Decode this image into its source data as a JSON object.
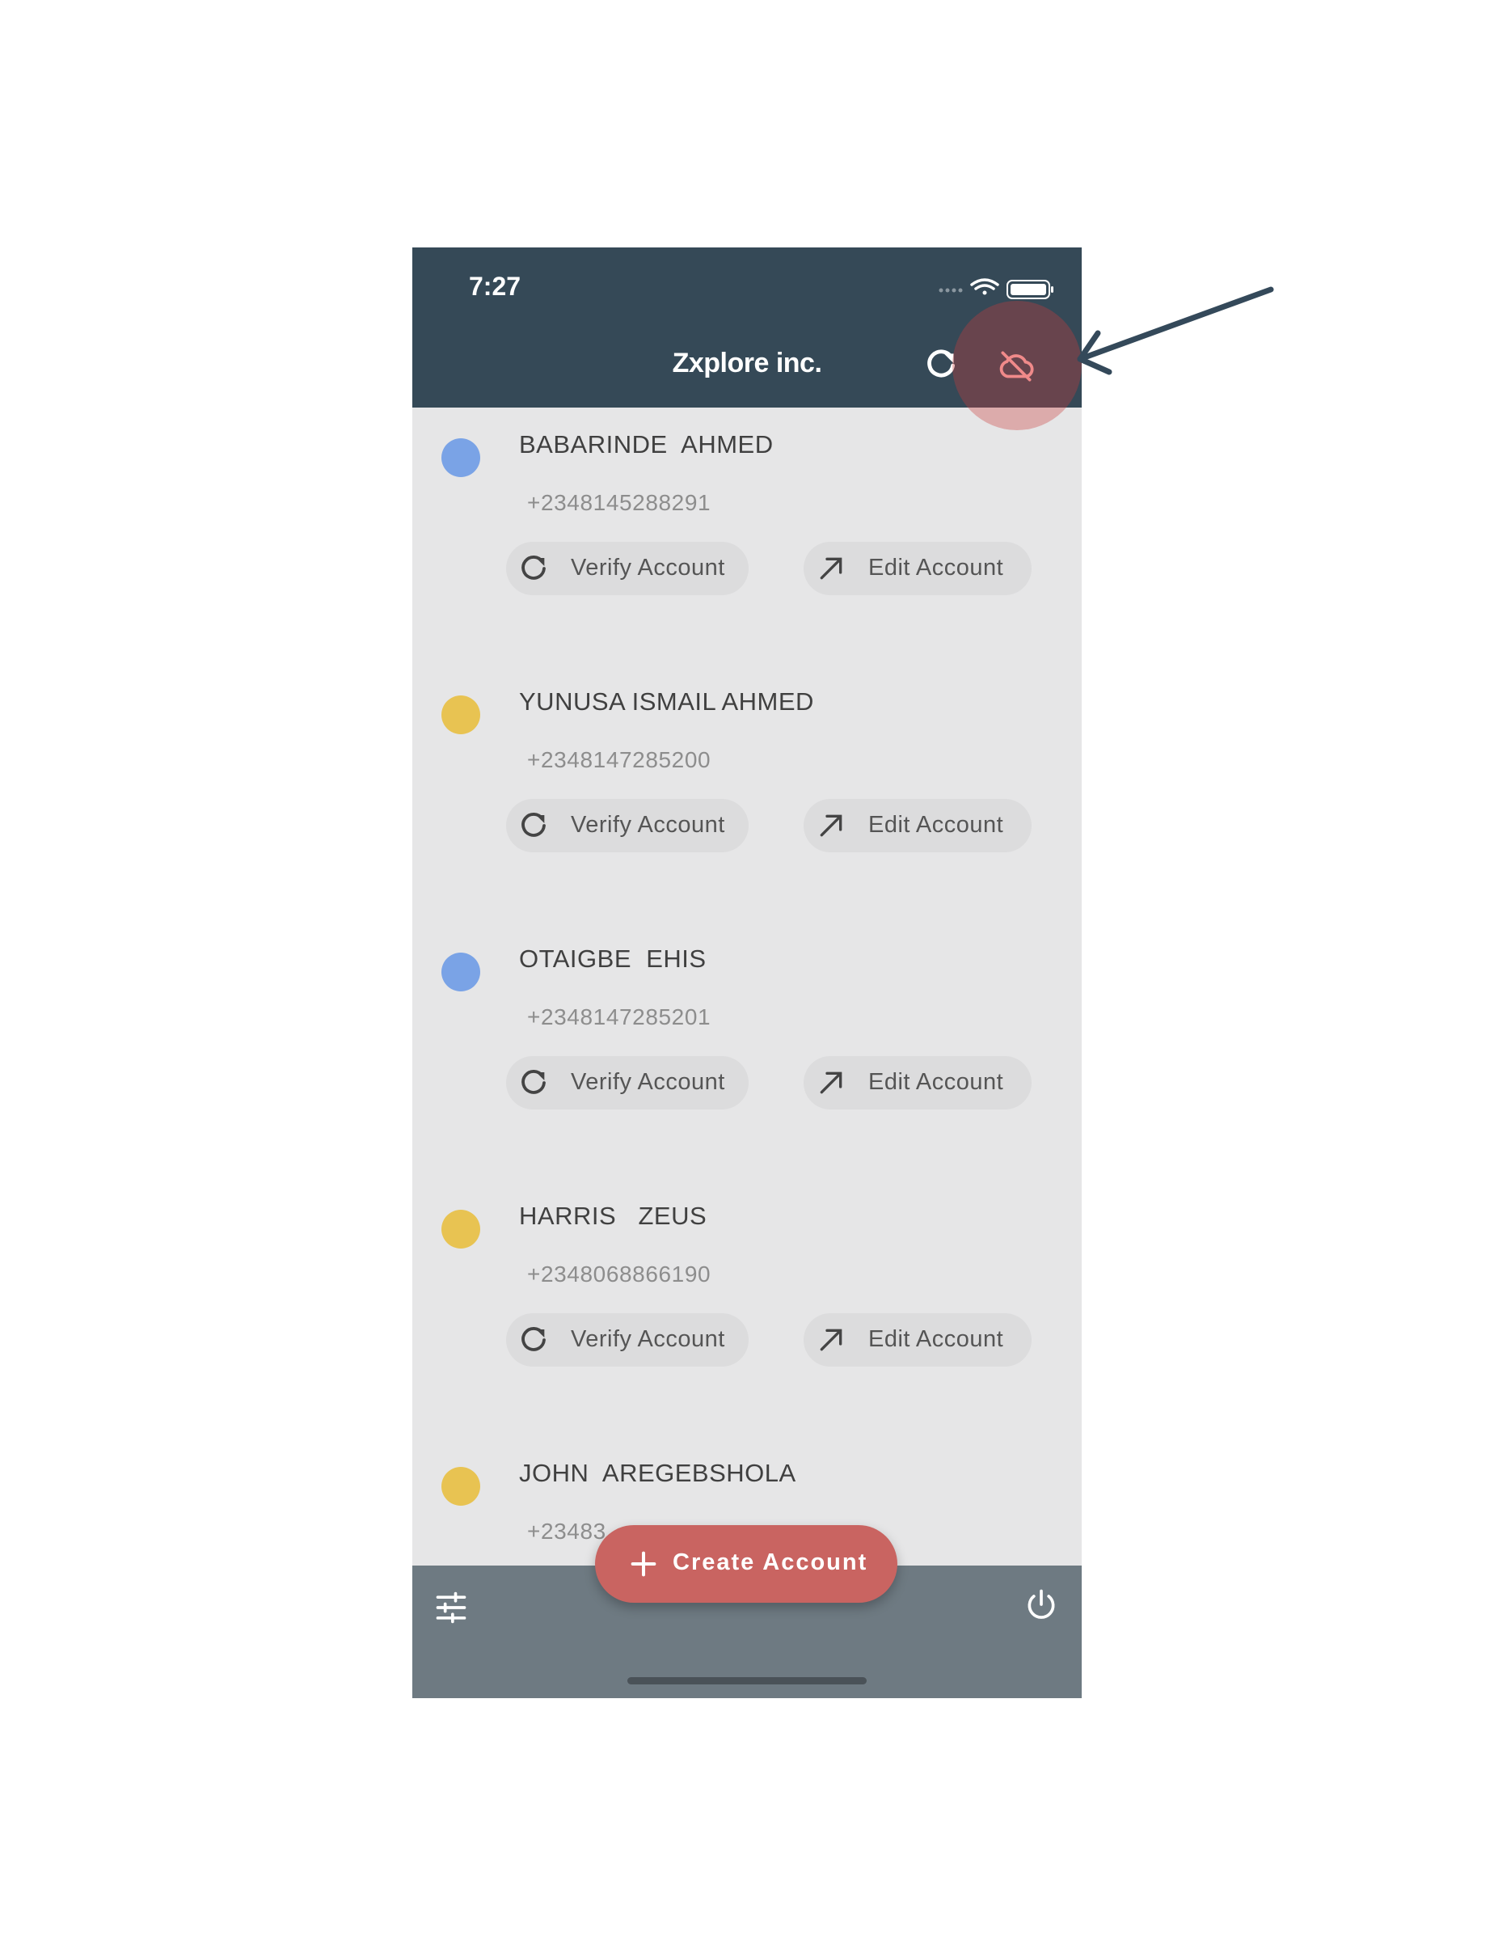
{
  "status_bar": {
    "time": "7:27"
  },
  "app_bar": {
    "title": "Zxplore inc."
  },
  "accounts": [
    {
      "name": "BABARINDE  AHMED",
      "phone": "+2348145288291",
      "dot_color": "#7aa3e6"
    },
    {
      "name": "YUNUSA ISMAIL AHMED",
      "phone": "+2348147285200",
      "dot_color": "#e8c352"
    },
    {
      "name": "OTAIGBE  EHIS",
      "phone": "+2348147285201",
      "dot_color": "#7aa3e6"
    },
    {
      "name": "HARRIS   ZEUS",
      "phone": "+2348068866190",
      "dot_color": "#e8c352"
    },
    {
      "name": "JOHN  AREGEBSHOLA",
      "phone": "+23483",
      "dot_color": "#e8c352"
    }
  ],
  "actions": {
    "verify_label": "Verify Account",
    "edit_label": "Edit Account"
  },
  "fab": {
    "label": "Create Account"
  },
  "icons": {
    "wifi": "wifi-icon",
    "battery": "battery-icon",
    "refresh": "refresh-icon",
    "offline": "cloud-off-icon",
    "edit": "arrow-up-right-icon",
    "filter": "tune-icon",
    "power": "power-icon",
    "add": "plus-icon"
  },
  "colors": {
    "app_bar": "#354957",
    "background": "#e6e6e7",
    "bottom_bar": "#6e7a82",
    "fab": "#c96461",
    "highlight": "#c64646",
    "offline_icon": "#f08a8a"
  }
}
